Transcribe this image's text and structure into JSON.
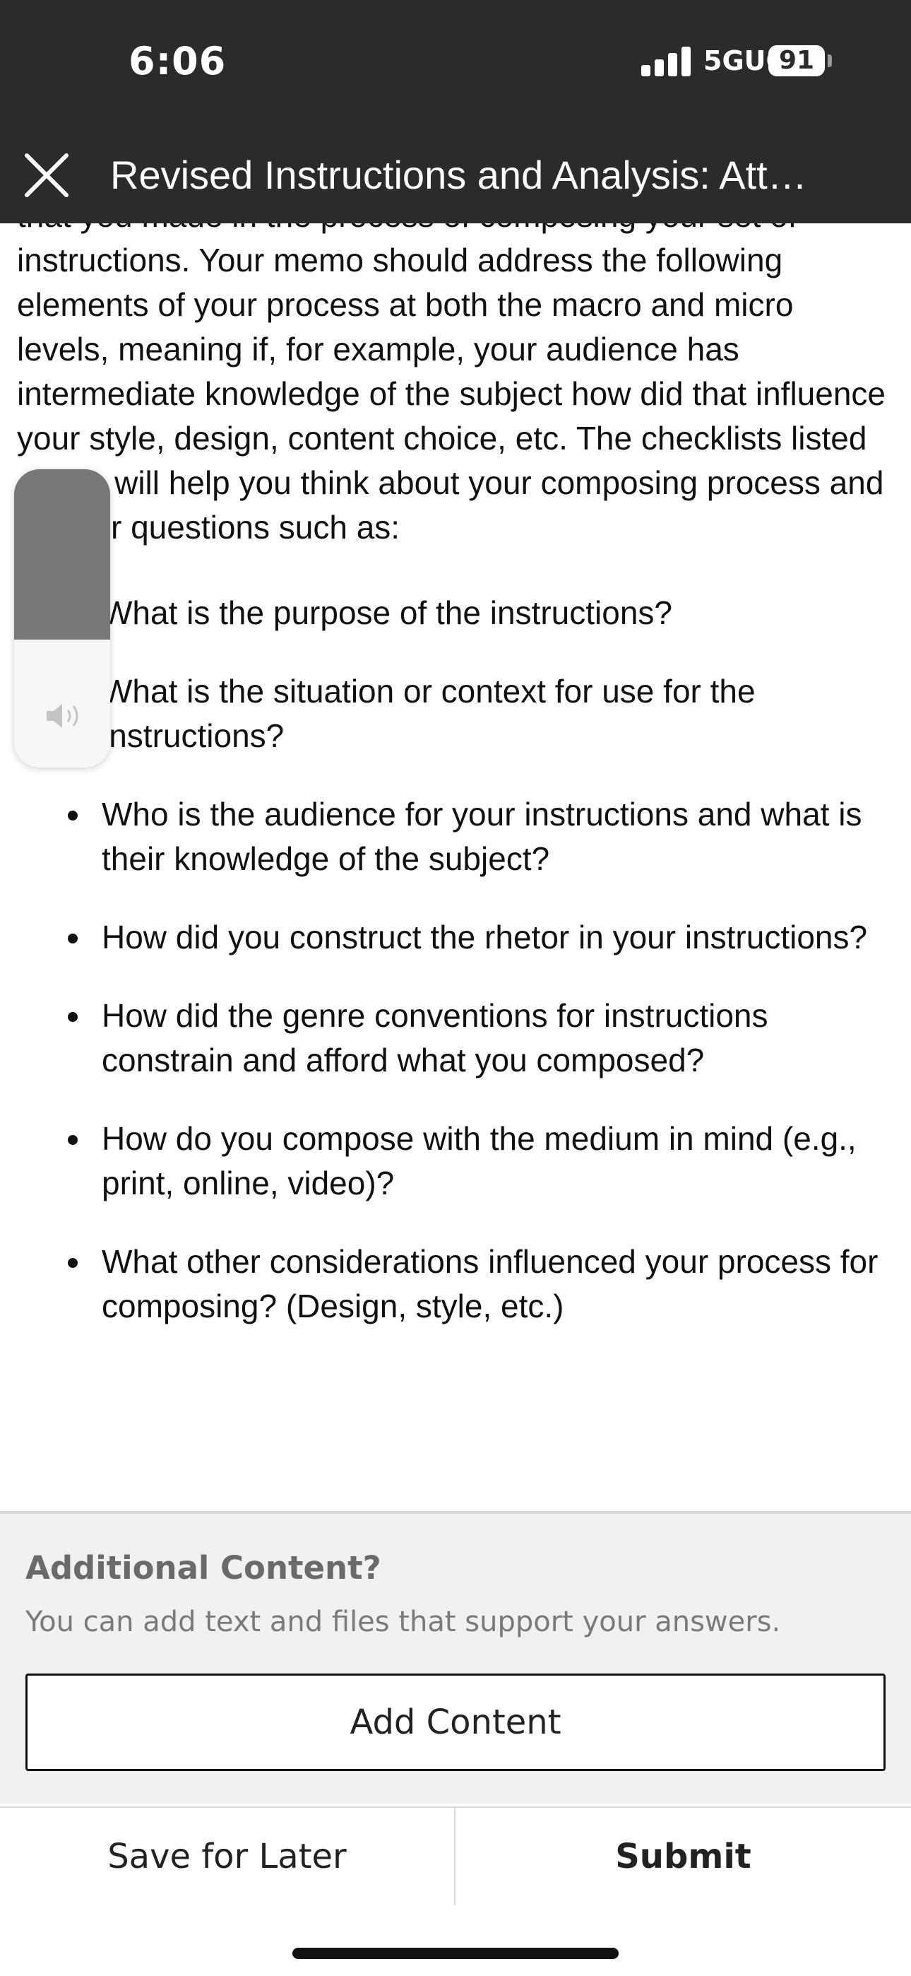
{
  "status_bar": {
    "time": "6:06",
    "network": "5GUC",
    "battery": "91"
  },
  "header": {
    "title": "Revised Instructions and Analysis: Att…"
  },
  "content": {
    "paragraph": "that you made in the process of composing your set of instructions. Your memo should address the following elements of your process at both the macro and micro levels, meaning if, for example, your audience has intermediate knowledge of the subject how did that influence your style, design, content choice, etc. The checklists listed above will help you think about your composing process and answer questions such as:",
    "bullets": [
      "What is the purpose of the instructions?",
      "What is the situation or context for use for the instructions?",
      "Who is the audience for your instructions and what is their knowledge of the subject?",
      "How did you construct the rhetor in your instructions?",
      "How did the genre conventions for instructions constrain and afford what you composed?",
      "How do you compose with the medium in mind (e.g., print, online, video)?",
      "What other considerations influenced your process for composing? (Design, style, etc.)"
    ]
  },
  "volume_hud": {
    "level": 0.57,
    "icon": "speaker-icon"
  },
  "additional": {
    "title": "Additional Content?",
    "description": "You can add text and files that support your answers.",
    "button_label": "Add Content"
  },
  "footer": {
    "save_label": "Save for Later",
    "submit_label": "Submit"
  }
}
